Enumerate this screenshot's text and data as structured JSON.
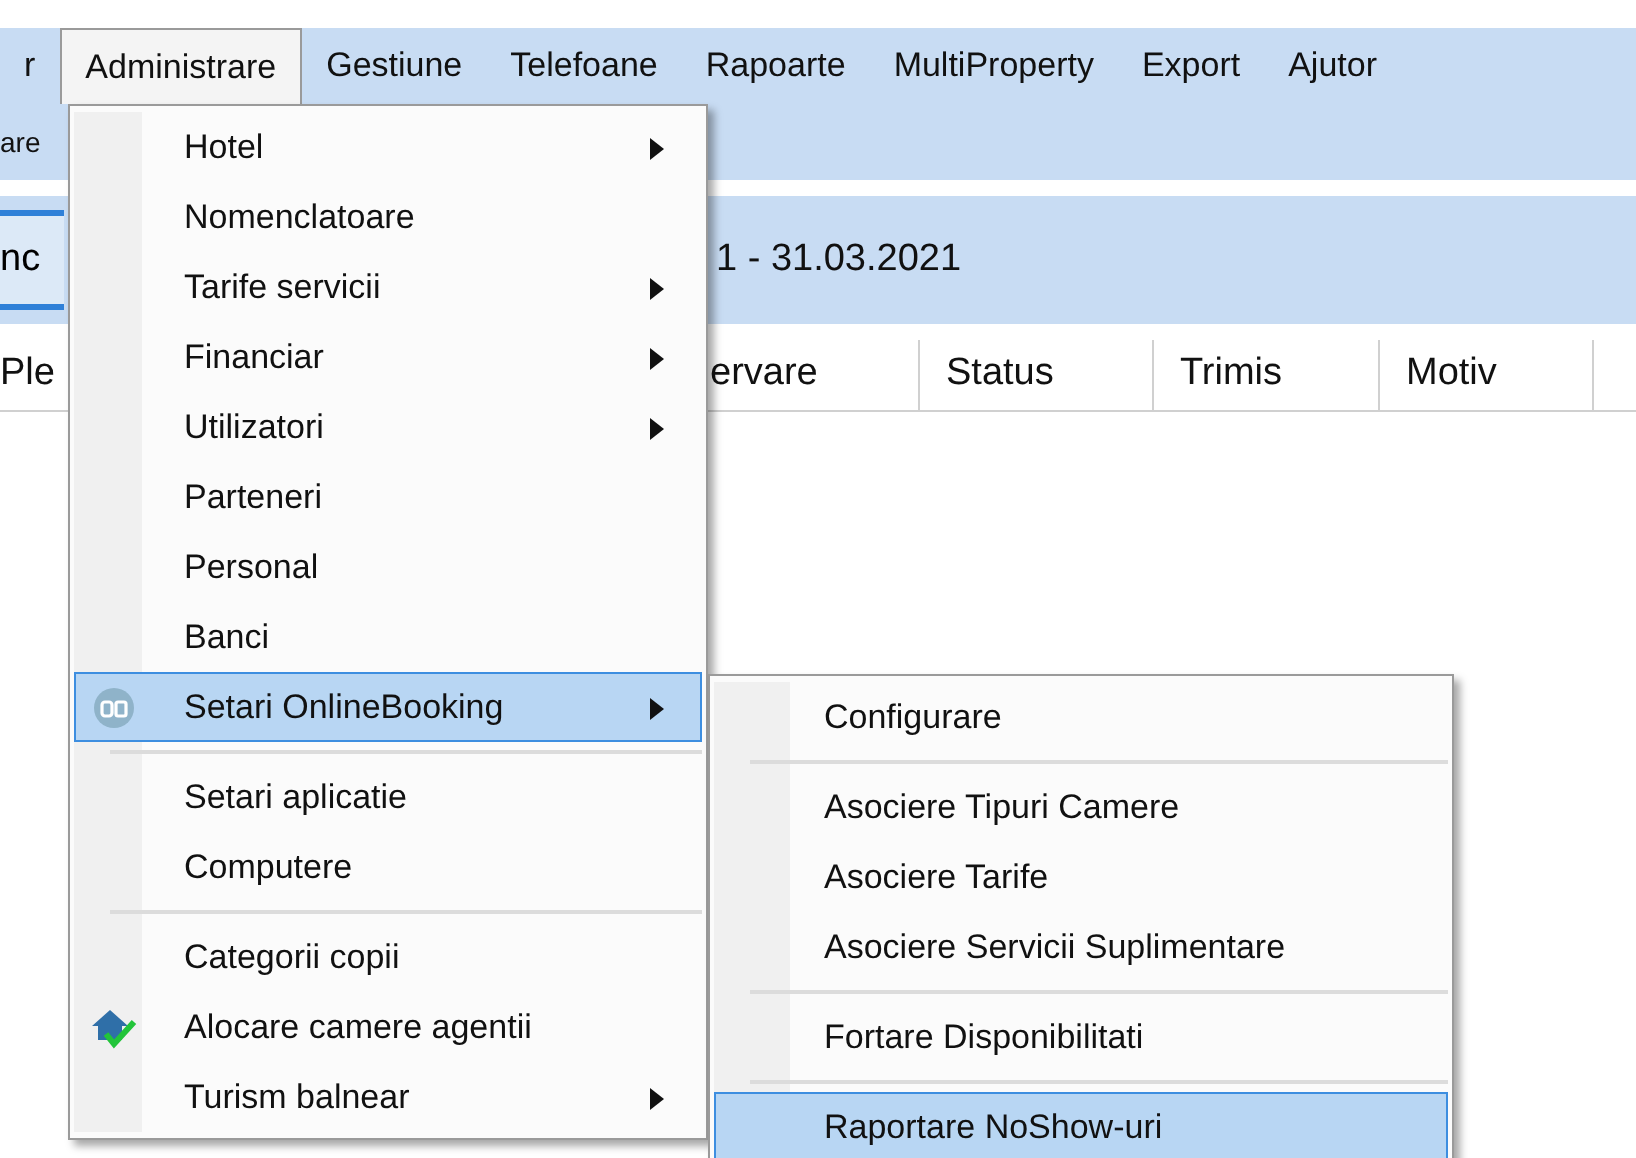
{
  "menu_bar": {
    "items": [
      {
        "label": "r",
        "selected": false
      },
      {
        "label": "Administrare",
        "selected": true
      },
      {
        "label": "Gestiune",
        "selected": false
      },
      {
        "label": "Telefoane",
        "selected": false
      },
      {
        "label": "Rapoarte",
        "selected": false
      },
      {
        "label": "MultiProperty",
        "selected": false
      },
      {
        "label": "Export",
        "selected": false
      },
      {
        "label": "Ajutor",
        "selected": false
      }
    ]
  },
  "toolbar": {
    "label": "are"
  },
  "date_panel": {
    "tab_label": "nc",
    "date_range": "1 - 31.03.2021"
  },
  "table": {
    "columns": [
      "Ple",
      "ervare",
      "Status",
      "Trimis",
      "Motiv"
    ]
  },
  "dropdown": {
    "items": [
      {
        "kind": "item",
        "label": "Hotel",
        "submenu": true,
        "selected": false
      },
      {
        "kind": "item",
        "label": "Nomenclatoare",
        "submenu": false,
        "selected": false
      },
      {
        "kind": "item",
        "label": "Tarife servicii",
        "submenu": true,
        "selected": false
      },
      {
        "kind": "item",
        "label": "Financiar",
        "submenu": true,
        "selected": false
      },
      {
        "kind": "item",
        "label": "Utilizatori",
        "submenu": true,
        "selected": false
      },
      {
        "kind": "item",
        "label": "Parteneri",
        "submenu": false,
        "selected": false
      },
      {
        "kind": "item",
        "label": "Personal",
        "submenu": false,
        "selected": false
      },
      {
        "kind": "item",
        "label": "Banci",
        "submenu": false,
        "selected": false
      },
      {
        "kind": "badge",
        "label": "Setari OnlineBooking",
        "submenu": true,
        "selected": true
      },
      {
        "kind": "separator"
      },
      {
        "kind": "item",
        "label": "Setari aplicatie",
        "submenu": false,
        "selected": false
      },
      {
        "kind": "item",
        "label": "Computere",
        "submenu": false,
        "selected": false
      },
      {
        "kind": "separator"
      },
      {
        "kind": "item",
        "label": "Categorii copii",
        "submenu": false,
        "selected": false
      },
      {
        "kind": "house",
        "label": "Alocare camere agentii",
        "submenu": false,
        "selected": false
      },
      {
        "kind": "item",
        "label": "Turism balnear",
        "submenu": true,
        "selected": false
      }
    ]
  },
  "submenu": {
    "items": [
      {
        "kind": "item",
        "label": "Configurare",
        "selected": false
      },
      {
        "kind": "separator"
      },
      {
        "kind": "item",
        "label": "Asociere Tipuri Camere",
        "selected": false
      },
      {
        "kind": "item",
        "label": "Asociere Tarife",
        "selected": false
      },
      {
        "kind": "item",
        "label": "Asociere Servicii Suplimentare",
        "selected": false
      },
      {
        "kind": "separator"
      },
      {
        "kind": "item",
        "label": "Fortare Disponibilitati",
        "selected": false
      },
      {
        "kind": "separator"
      },
      {
        "kind": "item",
        "label": "Raportare NoShow-uri",
        "selected": true
      }
    ]
  }
}
